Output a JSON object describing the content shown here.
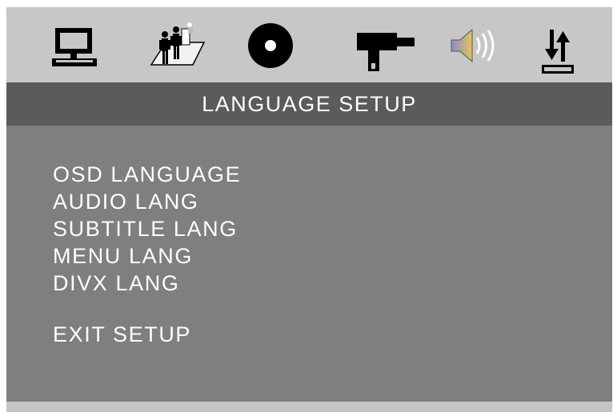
{
  "tabs": [
    {
      "icon": "monitor-icon",
      "name": "system"
    },
    {
      "icon": "people-icon",
      "name": "people"
    },
    {
      "icon": "disc-icon",
      "name": "disc"
    },
    {
      "icon": "gun-icon",
      "name": "gun"
    },
    {
      "icon": "speaker-icon",
      "name": "audio"
    },
    {
      "icon": "up-down-arrows-icon",
      "name": "arrows"
    }
  ],
  "title": "LANGUAGE SETUP",
  "menu": {
    "items": [
      "OSD LANGUAGE",
      "AUDIO LANG",
      "SUBTITLE LANG",
      "MENU LANG",
      "DIVX LANG"
    ],
    "exit": "EXIT SETUP"
  },
  "colors": {
    "icon_bar": "#c7c7c7",
    "title_bar": "#5b5b5b",
    "panel": "#7f7f7f",
    "text": "#ffffff"
  }
}
